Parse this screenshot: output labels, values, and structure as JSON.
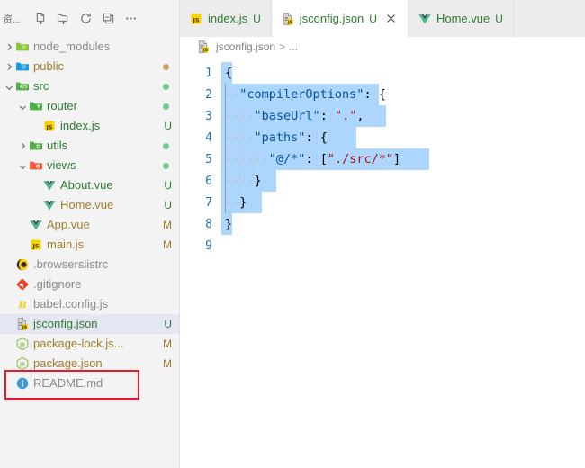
{
  "sidebar": {
    "title": "资...",
    "toolbar": [
      {
        "name": "new-file-icon",
        "label": "New File"
      },
      {
        "name": "new-folder-icon",
        "label": "New Folder"
      },
      {
        "name": "refresh-icon",
        "label": "Refresh Explorer"
      },
      {
        "name": "collapse-all-icon",
        "label": "Collapse Folders in Explorer"
      },
      {
        "name": "more-actions-icon",
        "label": "Views and More Actions..."
      }
    ],
    "items": [
      {
        "label": "node_modules",
        "indent": 0,
        "twisty": "right",
        "icon": "folder-green",
        "color": "c-gray",
        "status": "",
        "selected": false
      },
      {
        "label": "public",
        "indent": 0,
        "twisty": "right",
        "icon": "folder-blue",
        "color": "c-brown",
        "status": "dot-tan",
        "selected": false
      },
      {
        "label": "src",
        "indent": 0,
        "twisty": "down",
        "icon": "folder-src",
        "color": "c-green",
        "status": "dot-green",
        "selected": false
      },
      {
        "label": "router",
        "indent": 1,
        "twisty": "down",
        "icon": "folder-router",
        "color": "c-green",
        "status": "dot-green",
        "selected": false
      },
      {
        "label": "index.js",
        "indent": 2,
        "twisty": "none",
        "icon": "js",
        "color": "c-green",
        "status": "U",
        "selected": false
      },
      {
        "label": "utils",
        "indent": 1,
        "twisty": "right",
        "icon": "folder-utils",
        "color": "c-green",
        "status": "dot-green",
        "selected": false
      },
      {
        "label": "views",
        "indent": 1,
        "twisty": "down",
        "icon": "folder-views",
        "color": "c-green",
        "status": "dot-green",
        "selected": false
      },
      {
        "label": "About.vue",
        "indent": 2,
        "twisty": "none",
        "icon": "vue",
        "color": "c-green",
        "status": "U",
        "selected": false
      },
      {
        "label": "Home.vue",
        "indent": 2,
        "twisty": "none",
        "icon": "vue",
        "color": "c-brown",
        "status": "U",
        "selected": false
      },
      {
        "label": "App.vue",
        "indent": 1,
        "twisty": "none",
        "icon": "vue",
        "color": "c-brown",
        "status": "M",
        "selected": false
      },
      {
        "label": "main.js",
        "indent": 1,
        "twisty": "none",
        "icon": "js",
        "color": "c-brown",
        "status": "M",
        "selected": false
      },
      {
        "label": ".browserslistrc",
        "indent": 0,
        "twisty": "none",
        "icon": "browserslist",
        "color": "c-gray",
        "status": "",
        "selected": false
      },
      {
        "label": ".gitignore",
        "indent": 0,
        "twisty": "none",
        "icon": "git",
        "color": "c-gray",
        "status": "",
        "selected": false
      },
      {
        "label": "babel.config.js",
        "indent": 0,
        "twisty": "none",
        "icon": "babel",
        "color": "c-gray",
        "status": "",
        "selected": false
      },
      {
        "label": "jsconfig.json",
        "indent": 0,
        "twisty": "none",
        "icon": "jsconfig",
        "color": "c-green",
        "status": "U",
        "selected": true
      },
      {
        "label": "package-lock.js...",
        "indent": 0,
        "twisty": "none",
        "icon": "npm",
        "color": "c-brown",
        "status": "M",
        "selected": false
      },
      {
        "label": "package.json",
        "indent": 0,
        "twisty": "none",
        "icon": "npm",
        "color": "c-brown",
        "status": "M",
        "selected": false
      },
      {
        "label": "README.md",
        "indent": 0,
        "twisty": "none",
        "icon": "readme",
        "color": "c-gray",
        "status": "",
        "selected": false
      }
    ]
  },
  "annotation": {
    "color": "#e8192c",
    "target": "jsconfig.json"
  },
  "editor": {
    "tabs": [
      {
        "label": "index.js",
        "icon": "js",
        "status": "U",
        "active": false,
        "closable": false
      },
      {
        "label": "jsconfig.json",
        "icon": "jsconfig",
        "status": "U",
        "active": true,
        "closable": true
      },
      {
        "label": "Home.vue",
        "icon": "vue",
        "status": "U",
        "active": false,
        "closable": false
      }
    ],
    "breadcrumb": {
      "file": "jsconfig.json",
      "icon": "jsconfig",
      "separator": ">",
      "rest": "..."
    },
    "lines": [
      {
        "n": "1",
        "segments": [
          {
            "t": "{",
            "c": "tokp"
          }
        ]
      },
      {
        "n": "2",
        "segments": [
          {
            "t": "··",
            "c": "ws"
          },
          {
            "t": "\"compilerOptions\"",
            "c": "tokk"
          },
          {
            "t": ":",
            "c": "tokp"
          },
          {
            "t": "·",
            "c": "ws"
          },
          {
            "t": "{",
            "c": "tokp"
          }
        ]
      },
      {
        "n": "3",
        "segments": [
          {
            "t": "··",
            "c": "ws"
          },
          {
            "t": "··",
            "c": "ws"
          },
          {
            "t": "\"baseUrl\"",
            "c": "tokk"
          },
          {
            "t": ":",
            "c": "tokp"
          },
          {
            "t": "·",
            "c": "ws"
          },
          {
            "t": "\".\"",
            "c": "toks"
          },
          {
            "t": ",",
            "c": "tokp"
          }
        ]
      },
      {
        "n": "4",
        "segments": [
          {
            "t": "··",
            "c": "ws"
          },
          {
            "t": "··",
            "c": "ws"
          },
          {
            "t": "\"paths\"",
            "c": "tokk"
          },
          {
            "t": ":",
            "c": "tokp"
          },
          {
            "t": "·",
            "c": "ws"
          },
          {
            "t": "{",
            "c": "tokp"
          }
        ]
      },
      {
        "n": "5",
        "segments": [
          {
            "t": "··",
            "c": "ws"
          },
          {
            "t": "··",
            "c": "ws"
          },
          {
            "t": "··",
            "c": "ws"
          },
          {
            "t": "\"@/*\"",
            "c": "tokk"
          },
          {
            "t": ":",
            "c": "tokp"
          },
          {
            "t": "·",
            "c": "ws"
          },
          {
            "t": "[",
            "c": "tokp"
          },
          {
            "t": "\"./src/*\"",
            "c": "toks"
          },
          {
            "t": "]",
            "c": "tokp"
          }
        ]
      },
      {
        "n": "6",
        "segments": [
          {
            "t": "··",
            "c": "ws"
          },
          {
            "t": "··",
            "c": "ws"
          },
          {
            "t": "}",
            "c": "tokp"
          }
        ]
      },
      {
        "n": "7",
        "segments": [
          {
            "t": "··",
            "c": "ws"
          },
          {
            "t": "}",
            "c": "tokp"
          }
        ]
      },
      {
        "n": "8",
        "segments": [
          {
            "t": "}",
            "c": "tokp"
          }
        ]
      },
      {
        "n": "9",
        "segments": []
      }
    ]
  },
  "colors": {
    "selection": "#add6ff",
    "line_number": "#237893",
    "json_key": "#0451a5",
    "json_string": "#a31515",
    "annotation_red": "#e8192c",
    "status_untracked": "#2f7a33",
    "status_modified": "#9a7c2e"
  }
}
